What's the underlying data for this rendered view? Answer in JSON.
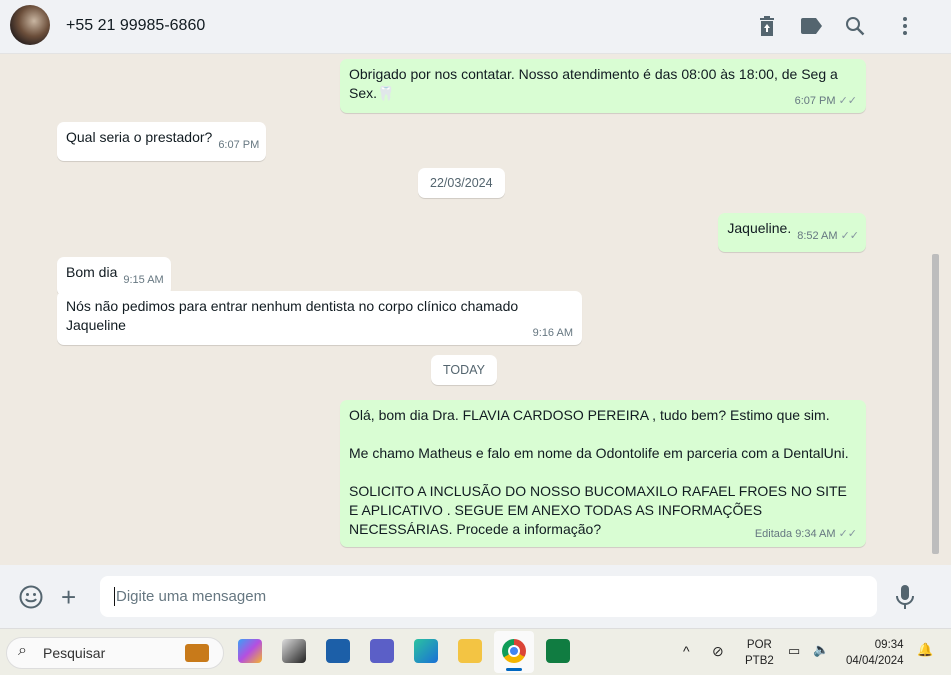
{
  "header": {
    "contact": "+55 21 99985-6860",
    "icons": [
      "archive-icon",
      "label-icon",
      "search-icon",
      "menu-icon"
    ]
  },
  "messages": [
    {
      "dir": "out",
      "text": "Obrigado por nos contatar. Nosso atendimento é das 08:00 às 18:00, de Seg a Sex.🦷",
      "time": "6:07 PM"
    },
    {
      "dir": "in",
      "text": "Qual seria o prestador?",
      "time": "6:07 PM"
    },
    {
      "dir": "out",
      "text": "Jaqueline.",
      "time": "8:52 AM"
    },
    {
      "dir": "in",
      "text": "Bom dia",
      "time": "9:15 AM"
    },
    {
      "dir": "in",
      "text": "Nós não pedimos para entrar nenhum dentista no corpo clínico chamado Jaqueline",
      "time": "9:16 AM"
    },
    {
      "dir": "out",
      "lines": [
        "Olá, bom dia Dra. FLAVIA CARDOSO PEREIRA , tudo bem? Estimo que sim.",
        "Me chamo Matheus e falo em nome da Odontolife em parceria com a DentalUni.",
        "SOLICITO A INCLUSÃO DO NOSSO BUCOMAXILO RAFAEL FROES NO SITE E APLICATIVO . SEGUE EM ANEXO TODAS AS INFORMAÇÕES NECESSÁRIAS. Procede a informação?"
      ],
      "time": "Editada 9:34 AM"
    }
  ],
  "dates": [
    "22/03/2024",
    "TODAY"
  ],
  "input": {
    "placeholder": "Digite uma mensagem"
  },
  "taskbar": {
    "search": "Pesquisar",
    "lang1": "POR",
    "lang2": "PTB2",
    "clock": "09:34",
    "date": "04/04/2024"
  }
}
